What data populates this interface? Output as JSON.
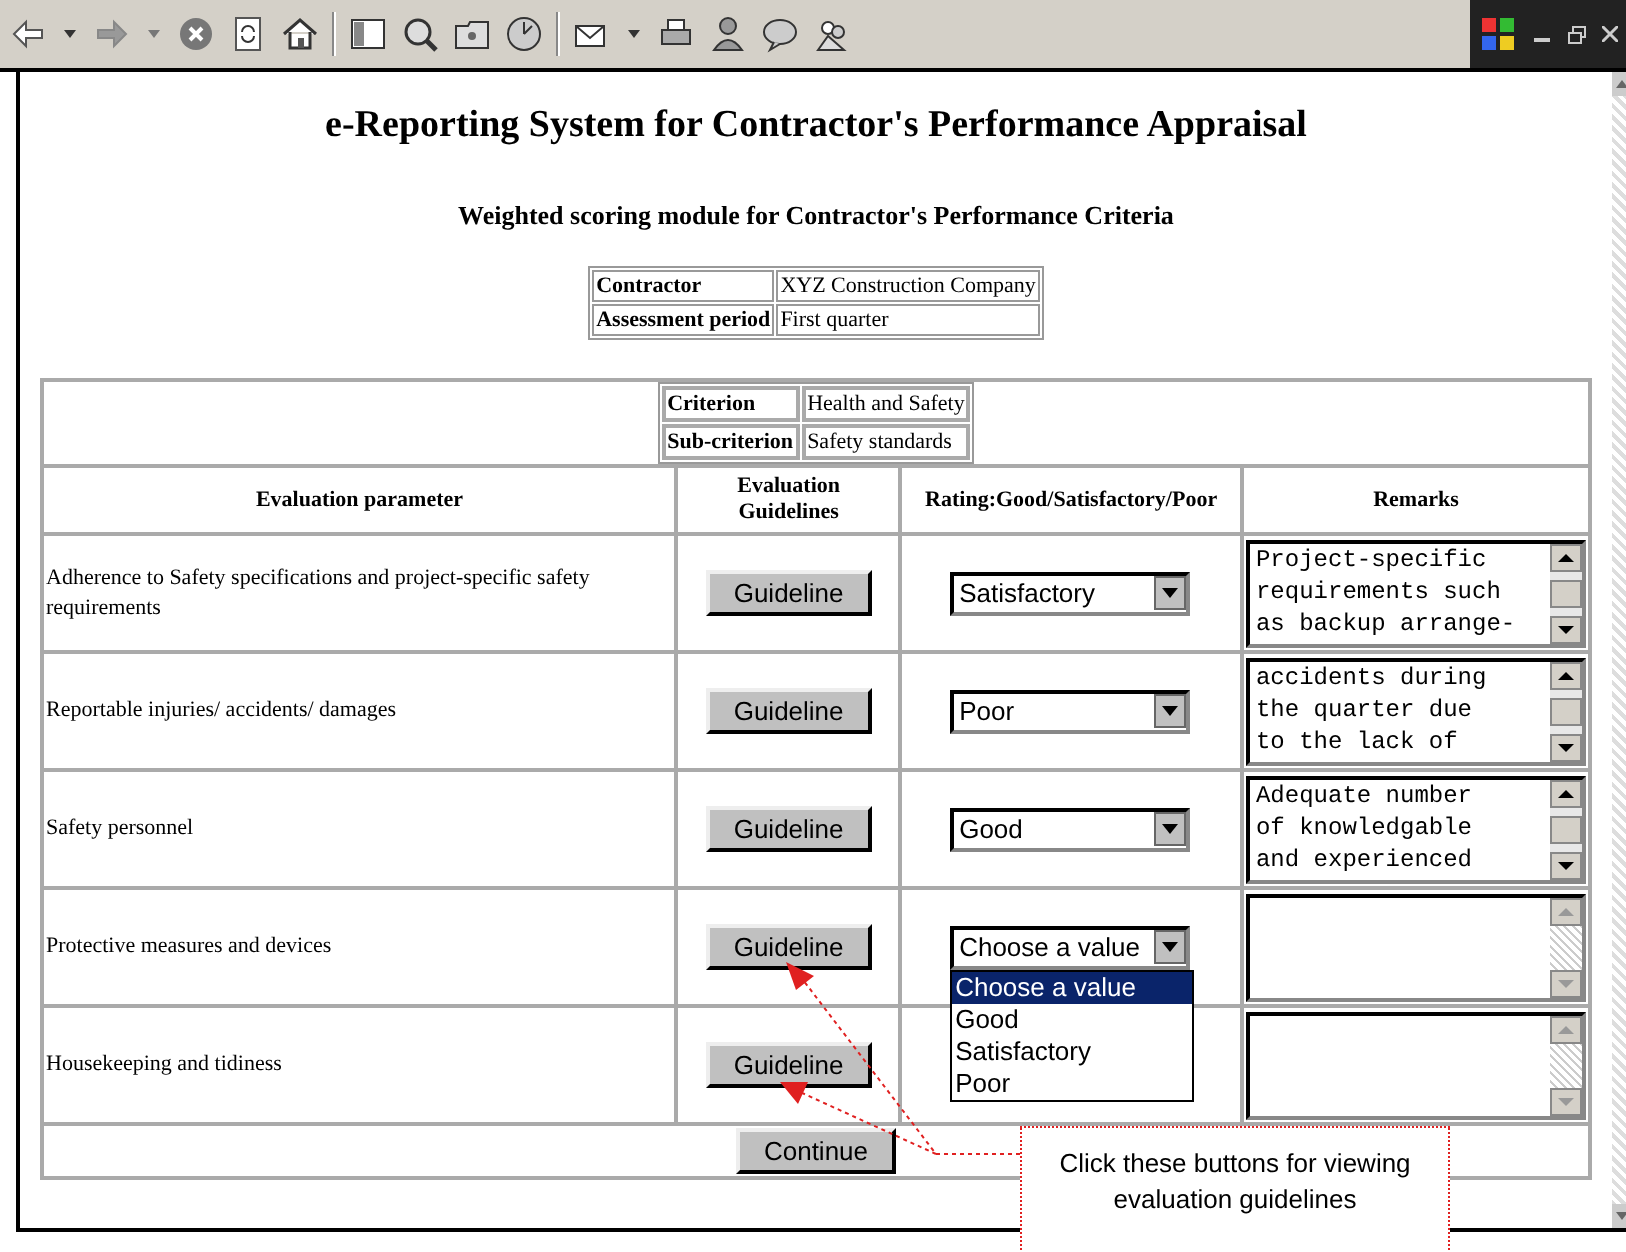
{
  "title": "e-Reporting System for Contractor's Performance Appraisal",
  "subtitle": "Weighted scoring module for Contractor's Performance Criteria",
  "contractor_table": [
    {
      "label": "Contractor",
      "value": "XYZ Construction Company"
    },
    {
      "label": "Assessment period",
      "value": "First quarter"
    }
  ],
  "criterion_table": [
    {
      "label": "Criterion",
      "value": "Health and Safety"
    },
    {
      "label": "Sub-criterion",
      "value": "Safety standards"
    }
  ],
  "columns": [
    "Evaluation parameter",
    "Evaluation Guidelines",
    "Rating:Good/Satisfactory/Poor",
    "Remarks"
  ],
  "rows": [
    {
      "parameter": "Adherence to Safety specifications and project-specific safety requirements",
      "button": "Guideline",
      "rating": "Satisfactory",
      "remarks_lines": [
        "Project-specific",
        "requirements such",
        "as backup arrange-"
      ]
    },
    {
      "parameter": "Reportable injuries/ accidents/ damages",
      "button": "Guideline",
      "rating": "Poor",
      "remarks_lines": [
        "accidents during",
        "the quarter due",
        "to the lack of"
      ]
    },
    {
      "parameter": "Safety personnel",
      "button": "Guideline",
      "rating": "Good",
      "remarks_lines": [
        "Adequate number",
        "of knowledgable",
        "and experienced"
      ]
    },
    {
      "parameter": "Protective measures and devices",
      "button": "Guideline",
      "rating": "Choose a value",
      "open": true,
      "options": [
        {
          "label": "Choose a value",
          "selected": true
        },
        {
          "label": "Good",
          "selected": false
        },
        {
          "label": "Satisfactory",
          "selected": false
        },
        {
          "label": "Poor",
          "selected": false
        }
      ]
    },
    {
      "parameter": "Housekeeping and tidiness",
      "button": "Guideline"
    }
  ],
  "continue_button": "Continue",
  "callout": {
    "text": "Click these buttons for viewing evaluation guidelines"
  }
}
